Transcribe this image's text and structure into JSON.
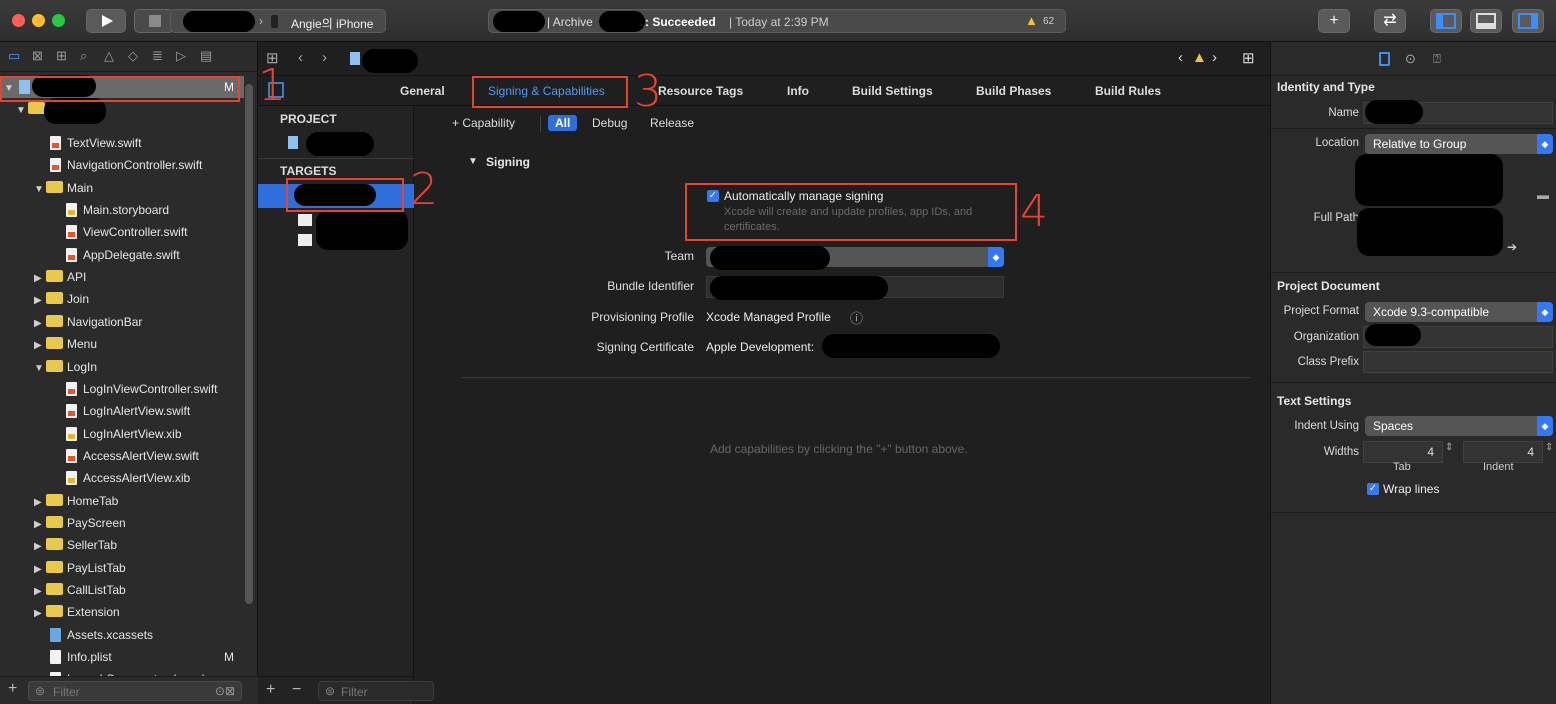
{
  "toolbar": {
    "device": "Angie의 iPhone",
    "status_prefix": "| Archive",
    "status_result": ": Succeeded",
    "status_time": "| Today at 2:39 PM",
    "warning_count": "62"
  },
  "navigator": {
    "root_badge": "M",
    "items": [
      {
        "label": "TextView.swift",
        "kind": "swift"
      },
      {
        "label": "NavigationController.swift",
        "kind": "swift"
      },
      {
        "label": "Main",
        "kind": "folder",
        "open": true
      },
      {
        "label": "Main.storyboard",
        "kind": "storyboard"
      },
      {
        "label": "ViewController.swift",
        "kind": "swift"
      },
      {
        "label": "AppDelegate.swift",
        "kind": "swift"
      },
      {
        "label": "API",
        "kind": "folder"
      },
      {
        "label": "Join",
        "kind": "folder"
      },
      {
        "label": "NavigationBar",
        "kind": "folder"
      },
      {
        "label": "Menu",
        "kind": "folder"
      },
      {
        "label": "LogIn",
        "kind": "folder",
        "open": true
      },
      {
        "label": "LogInViewController.swift",
        "kind": "swift"
      },
      {
        "label": "LogInAlertView.swift",
        "kind": "swift"
      },
      {
        "label": "LogInAlertView.xib",
        "kind": "storyboard"
      },
      {
        "label": "AccessAlertView.swift",
        "kind": "swift"
      },
      {
        "label": "AccessAlertView.xib",
        "kind": "storyboard"
      },
      {
        "label": "HomeTab",
        "kind": "folder"
      },
      {
        "label": "PayScreen",
        "kind": "folder"
      },
      {
        "label": "SellerTab",
        "kind": "folder"
      },
      {
        "label": "PayListTab",
        "kind": "folder"
      },
      {
        "label": "CallListTab",
        "kind": "folder"
      },
      {
        "label": "Extension",
        "kind": "folder"
      },
      {
        "label": "Assets.xcassets",
        "kind": "assets"
      },
      {
        "label": "Info.plist",
        "kind": "plist",
        "badge": "M"
      },
      {
        "label": "LaunchScreen.storyboard",
        "kind": "storyboard"
      }
    ],
    "filter_placeholder": "Filter"
  },
  "editor": {
    "tabs": [
      "General",
      "Signing & Capabilities",
      "Resource Tags",
      "Info",
      "Build Settings",
      "Build Phases",
      "Build Rules"
    ],
    "project_header": "PROJECT",
    "targets_header": "TARGETS",
    "capability_btn": "+ Capability",
    "filters": [
      "All",
      "Debug",
      "Release"
    ],
    "signing_header": "Signing",
    "auto_manage_label": "Automatically manage signing",
    "auto_manage_sub": "Xcode will create and update profiles, app IDs, and certificates.",
    "team_label": "Team",
    "bundle_label": "Bundle Identifier",
    "prov_label": "Provisioning Profile",
    "prov_value": "Xcode Managed Profile",
    "cert_label": "Signing Certificate",
    "cert_value": "Apple Development:",
    "empty_hint": "Add capabilities by clicking the \"+\" button above.",
    "filter_placeholder": "Filter"
  },
  "inspector": {
    "identity_header": "Identity and Type",
    "name_label": "Name",
    "location_label": "Location",
    "location_value": "Relative to Group",
    "fullpath_label": "Full Path",
    "doc_header": "Project Document",
    "format_label": "Project Format",
    "format_value": "Xcode 9.3-compatible",
    "org_label": "Organization",
    "prefix_label": "Class Prefix",
    "text_header": "Text Settings",
    "indent_label": "Indent Using",
    "indent_value": "Spaces",
    "widths_label": "Widths",
    "tab_value": "4",
    "indent_width_value": "4",
    "tab_caption": "Tab",
    "indent_caption": "Indent",
    "wrap_label": "Wrap lines"
  },
  "annotations": [
    "1",
    "2",
    "3",
    "4"
  ]
}
